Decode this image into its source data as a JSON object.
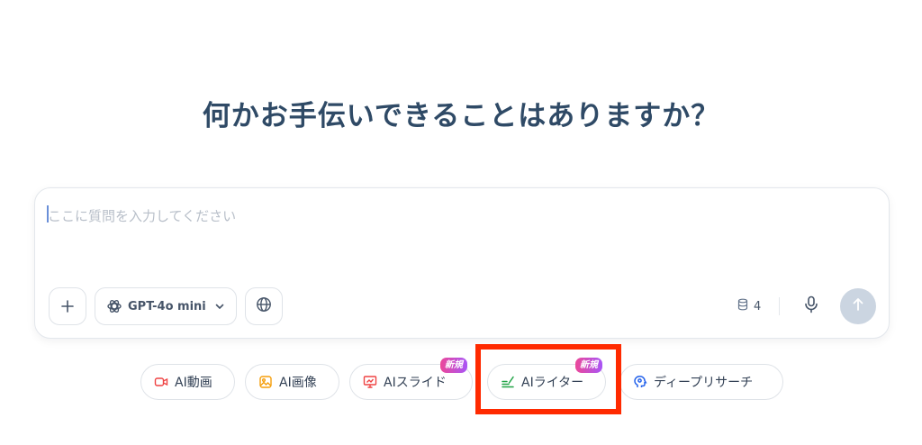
{
  "headline": "何かお手伝いできることはありますか？",
  "composer": {
    "placeholder": "ここに質問を入力してください",
    "value": "",
    "model": "GPT-4o mini",
    "credits": "4"
  },
  "quick_actions": {
    "video": "AI動画",
    "image": "AI画像",
    "slide": "AIスライド",
    "writer": "AIライター",
    "research": "ディープリサーチ",
    "new_badge": "新規"
  },
  "icons": {
    "add": "plus-icon",
    "model": "openai-logo-icon",
    "dropdown": "chevron-down-icon",
    "web": "globe-icon",
    "credits": "database-icon",
    "voice": "microphone-icon",
    "send": "arrow-up-icon"
  },
  "colors": {
    "headline": "#2f4a66",
    "send_button": "#cbd5e1",
    "new_badge_start": "#ec4899",
    "new_badge_end": "#a855f7",
    "highlight": "#ff2a00"
  }
}
